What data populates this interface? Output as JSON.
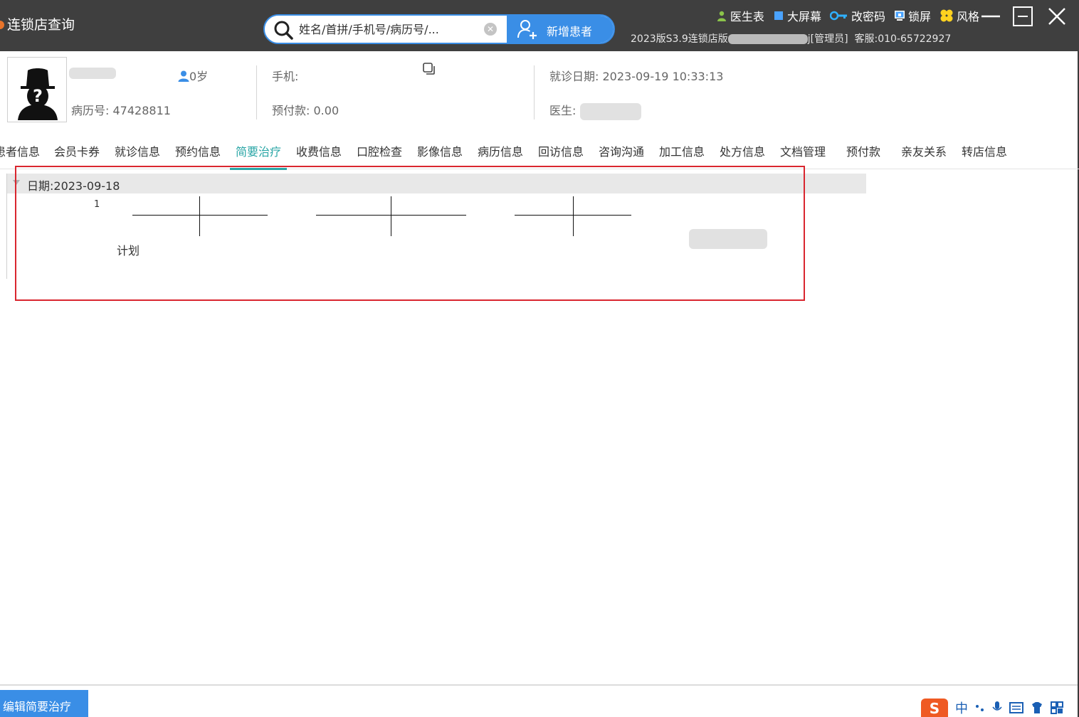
{
  "titlebar": {
    "app_title": "连锁店查询",
    "search_placeholder": "姓名/首拼/手机号/病历号/...",
    "new_patient_label": "新增患者",
    "menu": [
      {
        "label": "医生表",
        "icon": "doctor-icon",
        "color": "#8bc34a"
      },
      {
        "label": "大屏幕",
        "icon": "screen-icon",
        "color": "#4aa3ff"
      },
      {
        "label": "改密码",
        "icon": "key-icon",
        "color": "#2fb0ff"
      },
      {
        "label": "锁屏",
        "icon": "lock-screen-icon",
        "color": "#4aa3ff"
      },
      {
        "label": "风格",
        "icon": "style-icon",
        "color": "#ffd21f"
      }
    ],
    "version_prefix": "2023版S3.9连锁店版",
    "version_suffix": "j[管理员]",
    "support": "客服:010-65722927"
  },
  "patient": {
    "age": "0岁",
    "mrn_label": "病历号:",
    "mrn": "47428811",
    "phone_label": "手机:",
    "prepay_label": "预付款:",
    "prepay": "0.00",
    "visit_date_label": "就诊日期:",
    "visit_date": "2023-09-19 10:33:13",
    "doctor_label": "医生:"
  },
  "tabs": [
    {
      "label": "患者信息",
      "active": false
    },
    {
      "label": "会员卡券",
      "active": false
    },
    {
      "label": "就诊信息",
      "active": false
    },
    {
      "label": "预约信息",
      "active": false
    },
    {
      "label": "简要治疗",
      "active": true
    },
    {
      "label": "收费信息",
      "active": false
    },
    {
      "label": "口腔检查",
      "active": false
    },
    {
      "label": "影像信息",
      "active": false
    },
    {
      "label": "病历信息",
      "active": false
    },
    {
      "label": "回访信息",
      "active": false
    },
    {
      "label": "咨询沟通",
      "active": false
    },
    {
      "label": "加工信息",
      "active": false
    },
    {
      "label": "处方信息",
      "active": false
    },
    {
      "label": "文档管理",
      "active": false
    },
    {
      "label": "预付款",
      "active": false
    },
    {
      "label": "亲友关系",
      "active": false
    },
    {
      "label": "转店信息",
      "active": false
    }
  ],
  "treatment": {
    "group_label": "日期:2023-09-18",
    "row_number": "1",
    "plan_label": "计划"
  },
  "footer": {
    "edit_button": "编辑简要治疗",
    "ime_logo": "S",
    "ime_lang": "中"
  },
  "colors": {
    "accent": "#3a8ee6",
    "active_tab": "#2aa6a6",
    "highlight": "#d9262f",
    "titlebar": "#3f3f3f"
  }
}
